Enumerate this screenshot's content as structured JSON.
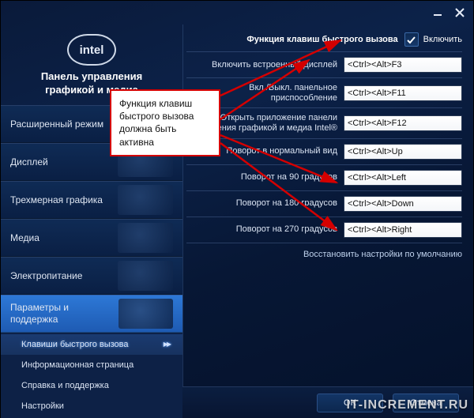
{
  "logo_text": "intel",
  "panel_title_l1": "Панель управления",
  "panel_title_l2": "графикой и медиа",
  "sidebar": {
    "categories": [
      {
        "label": "Расширенный режим"
      },
      {
        "label": "Дисплей"
      },
      {
        "label": "Трехмерная графика"
      },
      {
        "label": "Меди а",
        "clean": "Медиа"
      },
      {
        "label": "Электропитание"
      },
      {
        "label": "Параметры и поддержка"
      }
    ],
    "subitems": [
      {
        "label": "Клавиши быстрого вызова",
        "selected": true
      },
      {
        "label": "Информационная страница"
      },
      {
        "label": "Справка и поддержка"
      },
      {
        "label": "Настройки"
      }
    ]
  },
  "main": {
    "header_label": "Функция клавиш быстрого вызова",
    "enable_label": "Включить",
    "rows": [
      {
        "label": "Включить встроенный дисплей",
        "value": "<Ctrl><Alt>F3"
      },
      {
        "label": "Вкл./Выкл. панельное приспособление",
        "value": "<Ctrl><Alt>F11"
      },
      {
        "label_l1": "Открыть приложение панели",
        "label_l2": "управления графикой и медиа Intel®",
        "value": "<Ctrl><Alt>F12"
      },
      {
        "label": "Поворот в нормальный вид",
        "value": "<Ctrl><Alt>Up"
      },
      {
        "label": "Поворот на 90 градусов",
        "value": "<Ctrl><Alt>Left"
      },
      {
        "label": "Поворот на 180 градусов",
        "value": "<Ctrl><Alt>Down"
      },
      {
        "label": "Поворот на 270 градусов",
        "value": "<Ctrl><Alt>Right"
      }
    ],
    "restore": "Восстановить настройки по умолчанию"
  },
  "footer": {
    "ok": "OK",
    "cancel": "Отмена"
  },
  "annotation": "Функция клавиш быстрого вызова должна быть активна",
  "watermark": "IT-INCREMENT.RU"
}
